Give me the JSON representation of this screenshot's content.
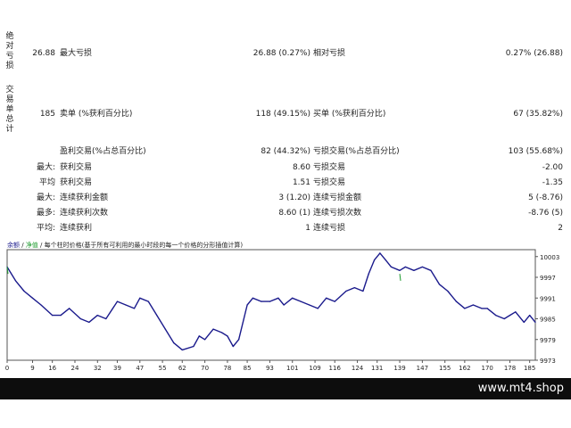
{
  "report": {
    "absolute_label": [
      "绝",
      "对",
      "亏",
      "损"
    ],
    "summary_label": [
      "交",
      "易",
      "单",
      "总",
      "计"
    ],
    "rows": [
      {
        "c1v": "26.88",
        "c2l": "最大亏损",
        "c2v": "26.88 (0.27%)",
        "c3l": "相对亏损",
        "c3v": "0.27% (26.88)"
      },
      {
        "c1v": "185",
        "c2l": "卖单 (%获利百分比)",
        "c2v": "118 (49.15%)",
        "c3l": "买单 (%获利百分比)",
        "c3v": "67 (35.82%)"
      },
      {
        "c1v": "",
        "c2l": "盈利交易(%占总百分比)",
        "c2v": "82 (44.32%)",
        "c3l": "亏损交易(%占总百分比)",
        "c3v": "103 (55.68%)"
      },
      {
        "c1l": "最大:",
        "c2l": "获利交易",
        "c2v": "8.60",
        "c3l": "亏损交易",
        "c3v": "-2.00"
      },
      {
        "c1l": "平均",
        "c2l": "获利交易",
        "c2v": "1.51",
        "c3l": "亏损交易",
        "c3v": "-1.35"
      },
      {
        "c1l": "最大:",
        "c2l": "连续获利金额",
        "c2v": "3 (1.20)",
        "c3l": "连续亏损金额",
        "c3v": "5 (-8.76)"
      },
      {
        "c1l": "最多:",
        "c2l": "连续获利次数",
        "c2v": "8.60 (1)",
        "c3l": "连续亏损次数",
        "c3v": "-8.76 (5)"
      },
      {
        "c1l": "平均:",
        "c2l": "连续获利",
        "c2v": "1",
        "c3l": "连续亏损",
        "c3v": "2"
      }
    ]
  },
  "chart_legend": {
    "item1": "余额",
    "sep": " / ",
    "item2": "净值",
    "rest": " / 每个柱时价格(基于所有可利用的最小时段的每一个价格的分形插值计算)"
  },
  "footer": {
    "brand": "www.mt4.shop"
  },
  "colors": {
    "line": "#1a1a8c",
    "equity": "#1f9b2f",
    "footer": "#0d0d0d"
  },
  "chart_data": {
    "type": "line",
    "x": [
      0,
      3,
      6,
      9,
      12,
      16,
      19,
      22,
      26,
      29,
      32,
      35,
      39,
      42,
      45,
      47,
      50,
      53,
      56,
      59,
      62,
      66,
      68,
      70,
      73,
      76,
      78,
      80,
      82,
      85,
      87,
      90,
      93,
      96,
      98,
      101,
      104,
      107,
      110,
      113,
      116,
      120,
      123,
      126,
      128,
      130,
      132,
      134,
      136,
      139,
      141,
      144,
      147,
      150,
      153,
      156,
      159,
      162,
      165,
      168,
      170,
      173,
      176,
      178,
      180,
      183,
      185,
      187
    ],
    "values": [
      10000,
      9996,
      9993,
      9991,
      9989,
      9986,
      9986,
      9988,
      9985,
      9984,
      9986,
      9985,
      9990,
      9989,
      9988,
      9991,
      9990,
      9986,
      9982,
      9978,
      9976,
      9977,
      9980,
      9979,
      9982,
      9981,
      9980,
      9977,
      9979,
      9989,
      9991,
      9990,
      9990,
      9991,
      9989,
      9991,
      9990,
      9989,
      9988,
      9991,
      9990,
      9993,
      9994,
      9993,
      9998,
      10002,
      10004,
      10002,
      10000,
      9999,
      10000,
      9999,
      10000,
      9999,
      9995,
      9993,
      9990,
      9988,
      9989,
      9988,
      9988,
      9986,
      9985,
      9986,
      9987,
      9984,
      9986,
      9984
    ],
    "xticks": [
      0,
      9,
      16,
      24,
      32,
      39,
      47,
      55,
      62,
      70,
      78,
      85,
      93,
      101,
      109,
      116,
      124,
      131,
      139,
      147,
      155,
      162,
      170,
      178,
      185
    ],
    "yticks": [
      10003,
      9997,
      9991,
      9985,
      9979,
      9973
    ],
    "ylim": [
      9973,
      10005
    ],
    "xlim": [
      0,
      187
    ],
    "grid": false
  }
}
